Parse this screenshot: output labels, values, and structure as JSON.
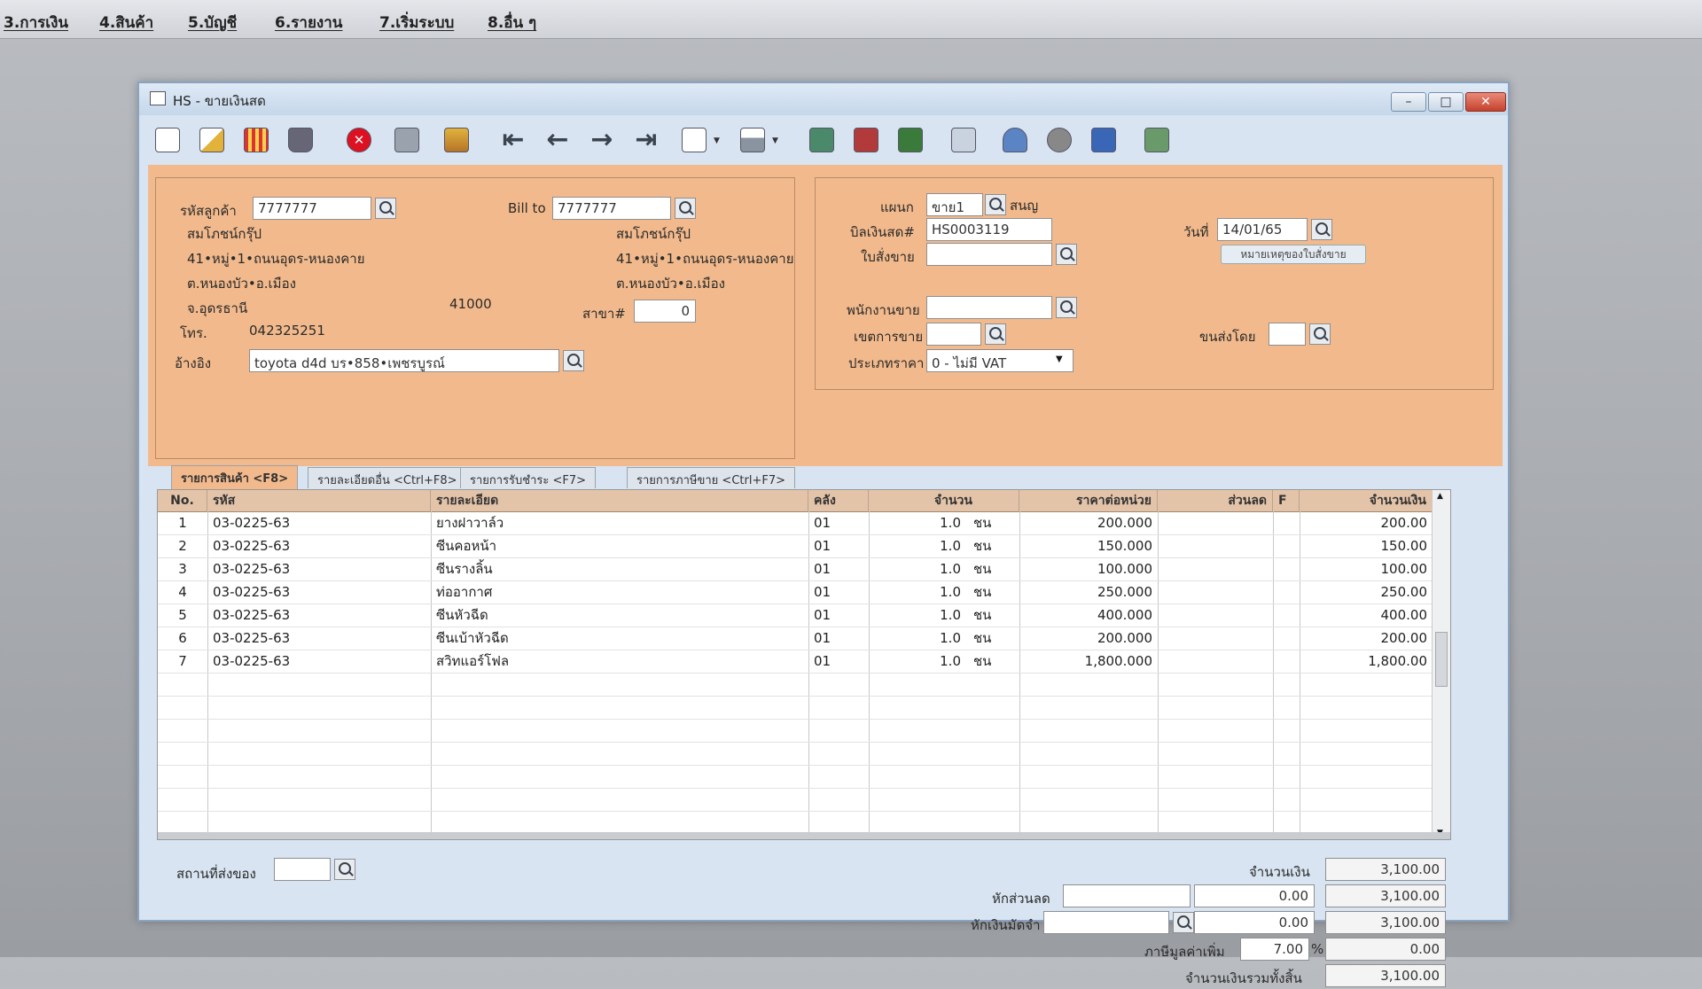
{
  "menu": {
    "items": [
      "3.การเงิน",
      "4.สินค้า",
      "5.บัญชี",
      "6.รายงาน",
      "7.เริ่มระบบ",
      "8.อื่น ๆ"
    ]
  },
  "window": {
    "title": "HS - ขายเงินสด",
    "buttons": {
      "minimize": "–",
      "maximize": "□",
      "close": "✕"
    }
  },
  "toolbar": {
    "icons": [
      "new-document-icon",
      "edit-icon",
      "ruler-icon",
      "trash-icon",
      "cancel-icon",
      "preview-icon",
      "stack-icon",
      "first-record-icon",
      "prev-record-icon",
      "next-record-icon",
      "last-record-icon",
      "find-icon",
      "print-icon",
      "screen-icon",
      "film-icon",
      "calc-icon",
      "table-icon",
      "person-ok-icon",
      "tools-icon",
      "ok-icon",
      "network-icon"
    ]
  },
  "customer": {
    "code_label": "รหัสลูกค้า",
    "code_value": "7777777",
    "name": "สมโภชน์กรุ๊ป",
    "address1": "41•หมู่•1•ถนนอุดร-หนองคาย",
    "address2": "ต.หนองบัว•อ.เมือง",
    "address3": "จ.อุดรธานี",
    "postcode": "41000",
    "phone_label": "โทร.",
    "phone": "042325251",
    "ref_label": "อ้างอิง",
    "ref_value": "toyota d4d บร•858•เพชรบูรณ์"
  },
  "billto": {
    "label": "Bill to",
    "value": "7777777",
    "name": "สมโภชน์กรุ๊ป",
    "address1": "41•หมู่•1•ถนนอุดร-หนองคาย",
    "address2": "ต.หนองบัว•อ.เมือง",
    "branch_label": "สาขา#",
    "branch_value": "0"
  },
  "doc": {
    "dept_label": "แผนก",
    "dept_value": "ขาย1",
    "dept_name": "สนญ",
    "bill_label": "บิลเงินสด#",
    "bill_value": "HS0003119",
    "date_label": "วันที่",
    "date_value": "14/01/65",
    "order_label": "ใบสั่งขาย",
    "order_value": "",
    "order_note_button": "หมายเหตุของใบสั่งขาย",
    "salesman_label": "พนักงานขาย",
    "salesman_value": "",
    "area_label": "เขตการขาย",
    "area_value": "",
    "ship_by_label": "ขนส่งโดย",
    "ship_by_value": "",
    "price_type_label": "ประเภทราคา",
    "price_type_value": "0 - ไม่มี VAT"
  },
  "tabs": [
    {
      "label": "รายการสินค้า <F8>"
    },
    {
      "label": "รายละเอียดอื่น <Ctrl+F8>"
    },
    {
      "label": "รายการรับชำระ <F7>"
    },
    {
      "label": "รายการภาษีขาย <Ctrl+F7>"
    }
  ],
  "grid": {
    "headers": [
      "No.",
      "รหัส",
      "รายละเอียด",
      "คลัง",
      "จำนวน",
      "ราคาต่อหน่วย",
      "ส่วนลด",
      "F",
      "จำนวนเงิน"
    ],
    "rows": [
      {
        "no": "1",
        "code": "03-0225-63",
        "desc": "ยางฝาวาล์ว",
        "wh": "01",
        "qty": "1.0",
        "unit": "ชน",
        "price": "200.000",
        "disc": "",
        "f": "",
        "amount": "200.00"
      },
      {
        "no": "2",
        "code": "03-0225-63",
        "desc": "ซีนคอหน้า",
        "wh": "01",
        "qty": "1.0",
        "unit": "ชน",
        "price": "150.000",
        "disc": "",
        "f": "",
        "amount": "150.00"
      },
      {
        "no": "3",
        "code": "03-0225-63",
        "desc": "ซีนรางลิ้น",
        "wh": "01",
        "qty": "1.0",
        "unit": "ชน",
        "price": "100.000",
        "disc": "",
        "f": "",
        "amount": "100.00"
      },
      {
        "no": "4",
        "code": "03-0225-63",
        "desc": "ท่ออากาศ",
        "wh": "01",
        "qty": "1.0",
        "unit": "ชน",
        "price": "250.000",
        "disc": "",
        "f": "",
        "amount": "250.00"
      },
      {
        "no": "5",
        "code": "03-0225-63",
        "desc": "ซีนหัวฉีด",
        "wh": "01",
        "qty": "1.0",
        "unit": "ชน",
        "price": "400.000",
        "disc": "",
        "f": "",
        "amount": "400.00"
      },
      {
        "no": "6",
        "code": "03-0225-63",
        "desc": "ซีนเบ้าหัวฉีด",
        "wh": "01",
        "qty": "1.0",
        "unit": "ชน",
        "price": "200.000",
        "disc": "",
        "f": "",
        "amount": "200.00"
      },
      {
        "no": "7",
        "code": "03-0225-63",
        "desc": "สวิทแอร์โฟล",
        "wh": "01",
        "qty": "1.0",
        "unit": "ชน",
        "price": "1,800.000",
        "disc": "",
        "f": "",
        "amount": "1,800.00"
      }
    ]
  },
  "footer": {
    "delivery_label": "สถานที่ส่งของ",
    "delivery_value": "",
    "amount_label": "จำนวนเงิน",
    "amount_value": "3,100.00",
    "discount_label": "หักส่วนลด",
    "discount_text": "",
    "discount_amount": "0.00",
    "after_discount": "3,100.00",
    "deposit_label": "หักเงินมัดจำ",
    "deposit_text": "",
    "deposit_amount": "0.00",
    "after_deposit": "3,100.00",
    "vat_label": "ภาษีมูลค่าเพิ่ม",
    "vat_rate": "7.00",
    "vat_pct": "%",
    "vat_amount": "0.00",
    "total_label": "จำนวนเงินรวมทั้งสิ้น",
    "total_value": "3,100.00"
  },
  "colors": {
    "panel": "#f2ba8c",
    "window": "#d8e4f1",
    "grid_header": "#e3c4a9"
  }
}
